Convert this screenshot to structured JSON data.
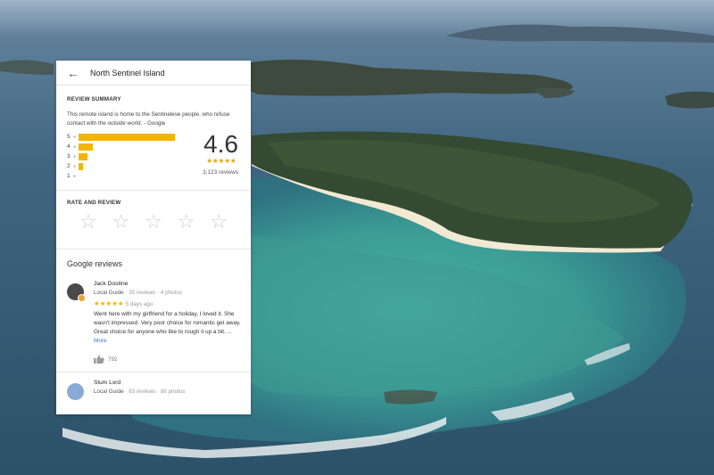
{
  "header": {
    "back_icon": "arrow-left-icon",
    "place_name": "North Sentinel Island"
  },
  "summary": {
    "heading": "REVIEW SUMMARY",
    "description": "This remote island is home to the Sentinelese people, who refuse contact with the outside world. - Google",
    "distribution": [
      {
        "stars": "5",
        "share": 1.0
      },
      {
        "stars": "4",
        "share": 0.15
      },
      {
        "stars": "3",
        "share": 0.09
      },
      {
        "stars": "2",
        "share": 0.05
      },
      {
        "stars": "1",
        "share": 0.0
      }
    ],
    "rating": "4.6",
    "rating_stars": "★★★★★",
    "review_count": "3,123 reviews",
    "bar_color": "#f4b400"
  },
  "rate": {
    "heading": "RATE AND REVIEW",
    "star_glyph": "☆"
  },
  "google_reviews": {
    "title": "Google reviews",
    "reviews": [
      {
        "name": "Jack Dostine",
        "role": "Local Guide",
        "stats": " · 35 reviews · 4 photos",
        "stars": "★★★★★",
        "time": "5 days ago",
        "text": "Went here with my girlfriend for a holiday, I loved it. She wasn't impressed. Very poor choice for romantic get away. Great choice for anyone who like to rough it up a bit. ...",
        "more": "More",
        "likes": "792"
      },
      {
        "name": "Slum Lxrd",
        "role": "Local Guide",
        "stats": " · 83 reviews · 88 photos"
      }
    ]
  }
}
